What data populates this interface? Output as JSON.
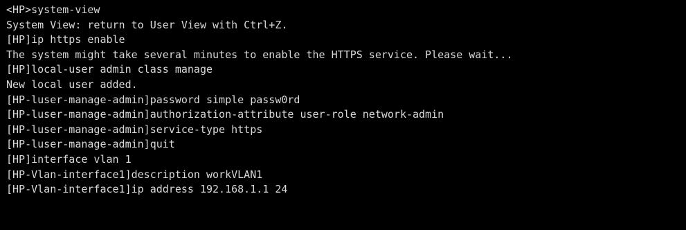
{
  "terminal": {
    "background": "#000000",
    "text_color": "#d9d9d9",
    "lines": [
      "<HP>system-view",
      "System View: return to User View with Ctrl+Z.",
      "[HP]ip https enable",
      "The system might take several minutes to enable the HTTPS service. Please wait...",
      "[HP]local-user admin class manage",
      "New local user added.",
      "[HP-luser-manage-admin]password simple passw0rd",
      "[HP-luser-manage-admin]authorization-attribute user-role network-admin",
      "[HP-luser-manage-admin]service-type https",
      "[HP-luser-manage-admin]quit",
      "[HP]interface vlan 1",
      "[HP-Vlan-interface1]description workVLAN1",
      "[HP-Vlan-interface1]ip address 192.168.1.1 24"
    ]
  }
}
